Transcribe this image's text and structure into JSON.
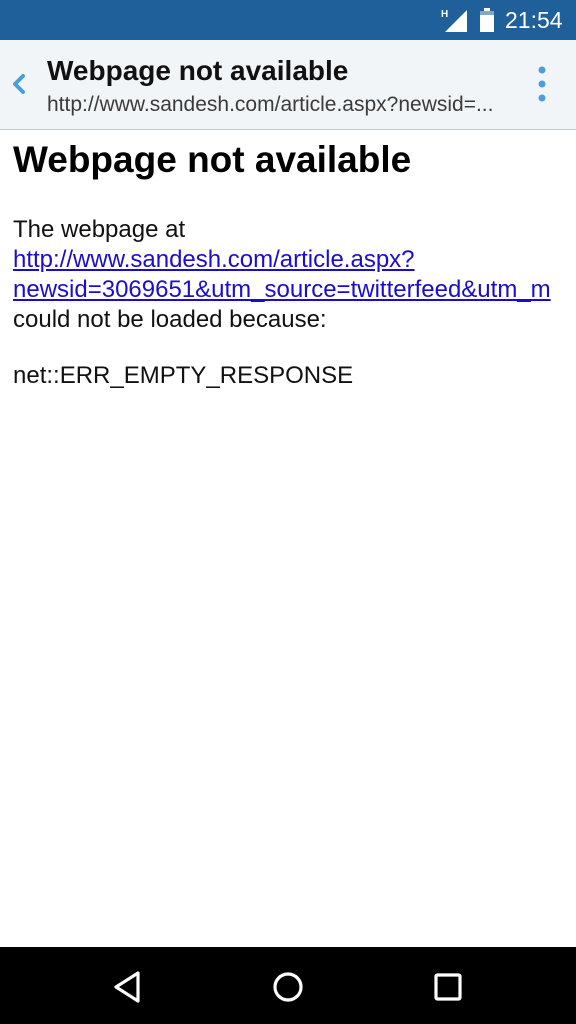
{
  "status_bar": {
    "network_type": "H",
    "time": "21:54"
  },
  "toolbar": {
    "title": "Webpage not available",
    "url": "http://www.sandesh.com/article.aspx?newsid=..."
  },
  "page": {
    "heading": "Webpage not available",
    "intro": "The webpage at",
    "link_line1": "http://www.sandesh.com/article.aspx?",
    "link_line2": "newsid=3069651&utm_source=twitterfeed&utm_m",
    "reason": "could not be loaded because:",
    "error_code": "net::ERR_EMPTY_RESPONSE"
  },
  "navigation": {
    "back": "back-icon",
    "home": "home-icon",
    "recents": "recents-icon"
  },
  "colors": {
    "status_bar": "#1f5f9a",
    "toolbar": "#f2f5f8",
    "link": "#1a0dcb",
    "accent": "#4a9fd8"
  }
}
